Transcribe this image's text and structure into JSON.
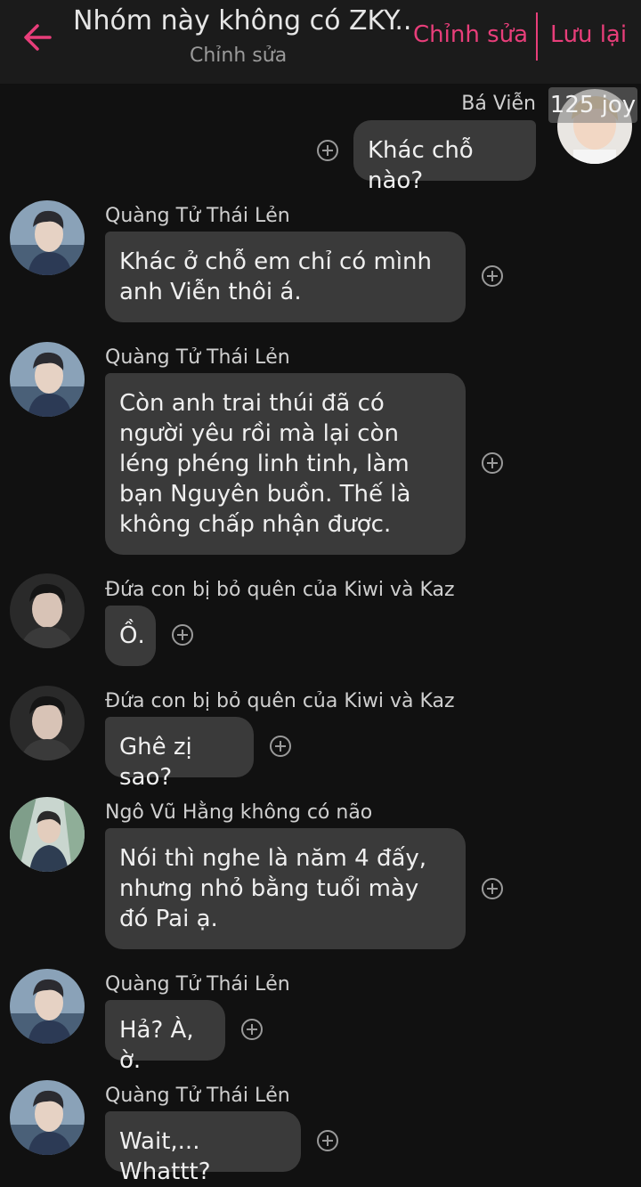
{
  "header": {
    "title": "Nhóm này không có ZKY...",
    "subtitle": "Chỉnh sửa",
    "edit_label": "Chỉnh sửa",
    "save_label": "Lưu lại",
    "back_icon": "back-arrow-icon",
    "accent_color": "#e83e7a"
  },
  "badge": "125 joy",
  "messages": [
    {
      "sender": "Bá Viễn",
      "text": "Khác chỗ nào?",
      "direction": "outgoing"
    },
    {
      "sender": "Quàng Tử Thái Lẻn",
      "text": "Khác ở chỗ em chỉ có mình anh Viễn thôi á.",
      "direction": "incoming"
    },
    {
      "sender": "Quàng Tử Thái Lẻn",
      "text": "Còn anh trai thúi đã có người yêu rồi mà lại còn léng phéng linh tinh, làm bạn Nguyên buồn. Thế là không chấp nhận được.",
      "direction": "incoming"
    },
    {
      "sender": "Đứa con bị bỏ quên của Kiwi và Kaz",
      "text": "Ồ.",
      "direction": "incoming"
    },
    {
      "sender": "Đứa con bị bỏ quên của Kiwi và Kaz",
      "text": "Ghê zị sao?",
      "direction": "incoming"
    },
    {
      "sender": "Ngô Vũ Hằng không có não",
      "text": "Nói thì nghe là năm 4 đấy, nhưng nhỏ bằng tuổi mày đó Pai ạ.",
      "direction": "incoming"
    },
    {
      "sender": "Quàng Tử Thái Lẻn",
      "text": "Hả? À, ờ.",
      "direction": "incoming"
    },
    {
      "sender": "Quàng Tử Thái Lẻn",
      "text": "Wait,... Whattt?",
      "direction": "incoming"
    }
  ],
  "colors": {
    "background": "#111111",
    "header": "#1b1b1b",
    "bubble": "#3a3a3a",
    "text": "#efefef"
  }
}
